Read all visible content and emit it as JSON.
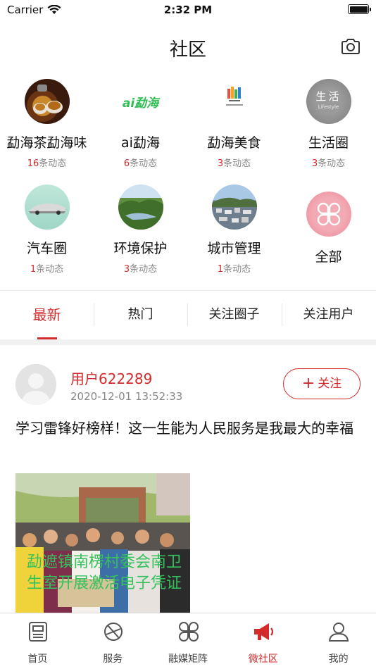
{
  "status_bar": {
    "carrier": "Carrier",
    "time": "2:32 PM"
  },
  "nav": {
    "title": "社区",
    "camera_icon": "camera-icon"
  },
  "circles": [
    {
      "name": "勐海茶勐海味",
      "count": "16",
      "suffix": "条动态",
      "icon": "tea-photo"
    },
    {
      "name": "ai勐海",
      "count": "6",
      "suffix": "条动态",
      "icon": "ai-menghai-logo",
      "logo_text": "ai勐海"
    },
    {
      "name": "勐海美食",
      "count": "3",
      "suffix": "条动态",
      "icon": "food-logo"
    },
    {
      "name": "生活圈",
      "count": "3",
      "suffix": "条动态",
      "icon": "lifestyle-badge",
      "logo_text": "生活",
      "logo_sub": "Lifestyle"
    },
    {
      "name": "汽车圈",
      "count": "1",
      "suffix": "条动态",
      "icon": "car-photo"
    },
    {
      "name": "环境保护",
      "count": "3",
      "suffix": "条动态",
      "icon": "landscape-photo"
    },
    {
      "name": "城市管理",
      "count": "1",
      "suffix": "条动态",
      "icon": "city-photo"
    },
    {
      "name": "全部",
      "icon": "all-grid-icon"
    }
  ],
  "tabs": [
    "最新",
    "热门",
    "关注圈子",
    "关注用户"
  ],
  "active_tab": 0,
  "post": {
    "username": "用户622289",
    "timestamp": "2020-12-01 13:52:33",
    "follow_label": "关注",
    "content": "学习雷锋好榜样！这一生能为人民服务是我最大的幸福",
    "image_caption": "勐遮镇南楞村委会南卫生室开展激活电子凭证"
  },
  "tabbar": [
    {
      "label": "首页",
      "icon": "news-icon"
    },
    {
      "label": "服务",
      "icon": "service-icon"
    },
    {
      "label": "融媒矩阵",
      "icon": "matrix-icon"
    },
    {
      "label": "微社区",
      "icon": "megaphone-icon"
    },
    {
      "label": "我的",
      "icon": "user-icon"
    }
  ],
  "active_tabbar": 3,
  "colors": {
    "accent": "#d32b2b",
    "text": "#111111",
    "muted": "#888888"
  }
}
